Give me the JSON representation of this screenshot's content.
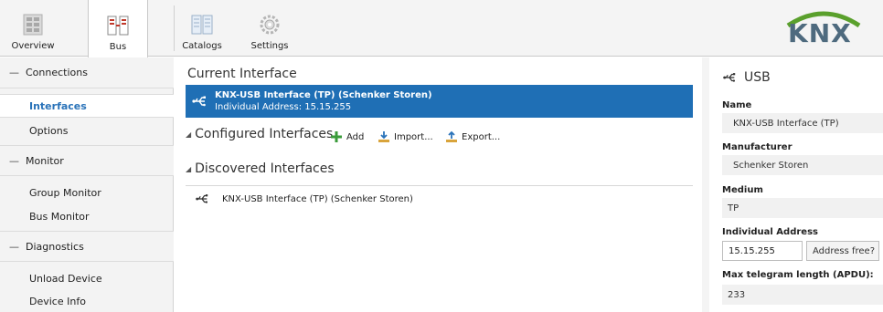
{
  "toolbar": {
    "buttons": [
      {
        "label": "Overview",
        "icon": "overview-icon"
      },
      {
        "label": "Bus",
        "icon": "bus-icon"
      },
      {
        "label": "Catalogs",
        "icon": "catalogs-icon"
      },
      {
        "label": "Settings",
        "icon": "settings-gear-icon"
      }
    ],
    "active": "Bus",
    "logo": "KNX"
  },
  "sidebar": {
    "groups": [
      {
        "label": "Connections",
        "items": [
          "Interfaces",
          "Options"
        ]
      },
      {
        "label": "Monitor",
        "items": [
          "Group Monitor",
          "Bus Monitor"
        ]
      },
      {
        "label": "Diagnostics",
        "items": [
          "Unload Device",
          "Device Info"
        ]
      }
    ],
    "selected": "Interfaces"
  },
  "main": {
    "current_title": "Current Interface",
    "current": {
      "name": "KNX-USB Interface (TP) (Schenker Storen)",
      "address_line": "Individual Address: 15.15.255"
    },
    "configured_title": "Configured Interfaces",
    "actions": {
      "add": "Add",
      "import": "Import...",
      "export": "Export..."
    },
    "discovered_title": "Discovered Interfaces",
    "discovered": [
      "KNX-USB Interface (TP) (Schenker Storen)"
    ]
  },
  "properties": {
    "header": "USB",
    "name_label": "Name",
    "name_value": "KNX-USB Interface (TP)",
    "manufacturer_label": "Manufacturer",
    "manufacturer_value": "Schenker Storen",
    "medium_label": "Medium",
    "medium_value": "TP",
    "address_label": "Individual Address",
    "address_value": "15.15.255",
    "address_button": "Address free?",
    "apdu_label": "Max telegram length (APDU):",
    "apdu_value": "233"
  },
  "colors": {
    "selection": "#1f6fb5",
    "link_blue": "#2a73b9",
    "add_green": "#3a9b3a",
    "logo_text": "#4e6a7e"
  }
}
